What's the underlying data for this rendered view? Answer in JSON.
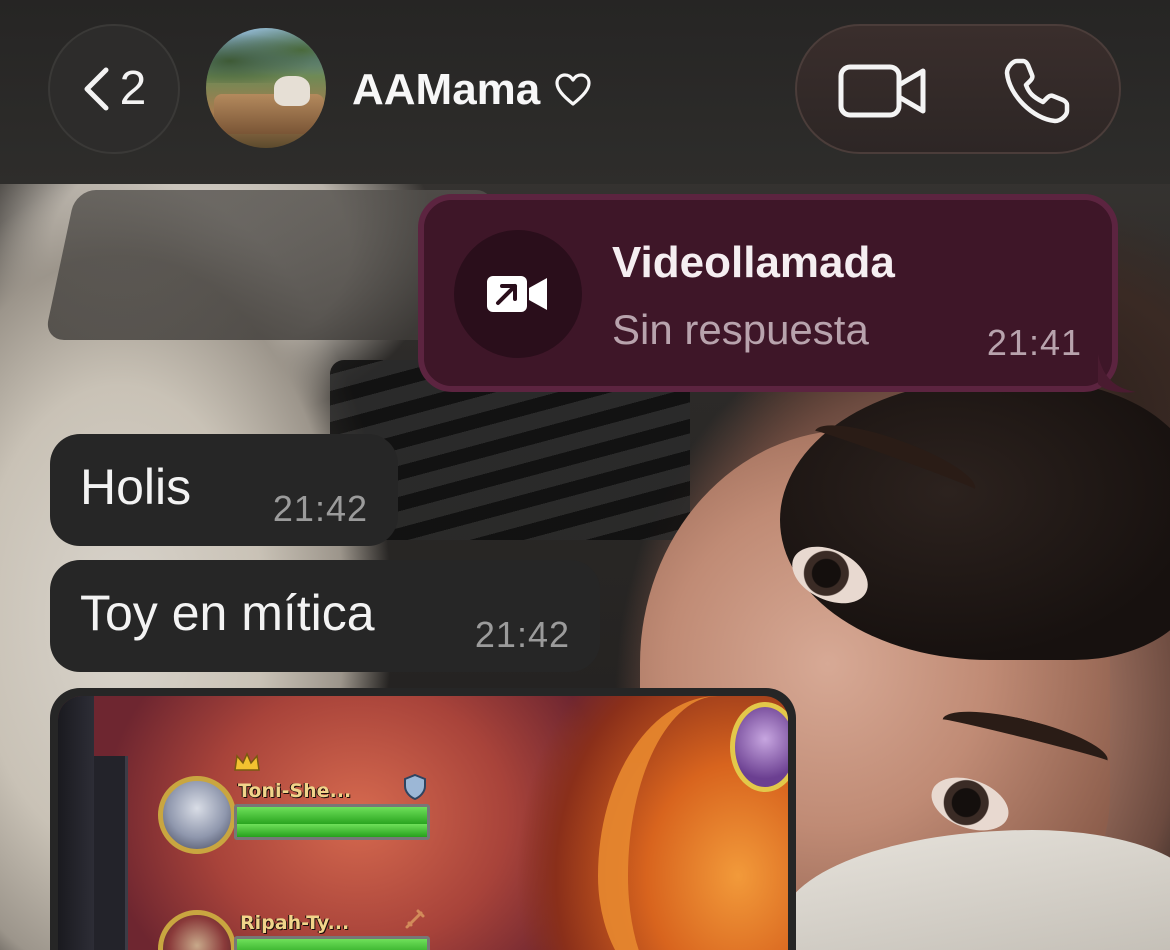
{
  "header": {
    "back_count": "2",
    "contact_name": "AAMama",
    "icons": {
      "back": "chevron-left-icon",
      "heart": "heart-outline-icon",
      "video": "video-camera-icon",
      "phone": "phone-icon"
    }
  },
  "messages": [
    {
      "type": "call",
      "direction": "outgoing",
      "title": "Videollamada",
      "status": "Sin respuesta",
      "time": "21:41",
      "icon": "outgoing-video-call-icon"
    },
    {
      "type": "text",
      "direction": "incoming",
      "text": "Holis",
      "time": "21:42"
    },
    {
      "type": "text",
      "direction": "incoming",
      "text": "Toy en mítica",
      "time": "21:42"
    },
    {
      "type": "image",
      "direction": "incoming",
      "image_content": {
        "unit_names": [
          "Toni-She...",
          "Ripah-Ty..."
        ],
        "health": [
          1.0,
          1.0
        ]
      }
    }
  ],
  "colors": {
    "outgoing_bubble": "#3e1628",
    "incoming_bubble": "#262626",
    "header_bg": "#2a2928",
    "health_green": "#3cc22c"
  }
}
